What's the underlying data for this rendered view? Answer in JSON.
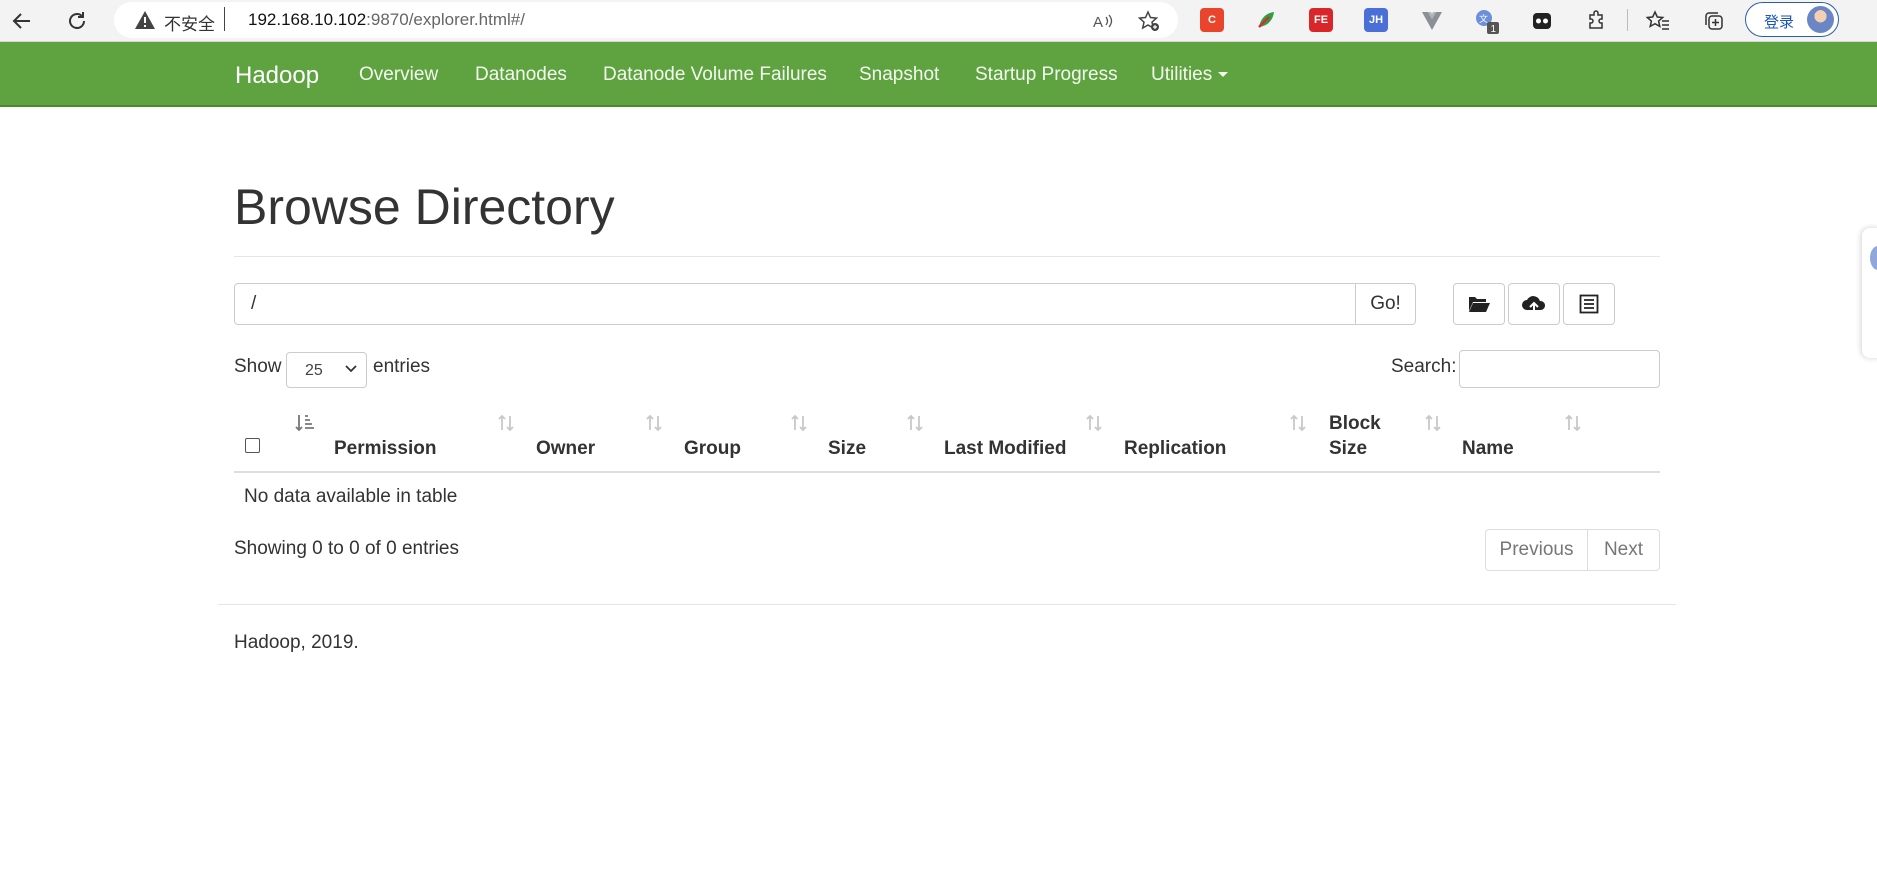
{
  "browser": {
    "insecure_label": "不安全",
    "url_host": "192.168.10.102",
    "url_rest": ":9870/explorer.html#/",
    "ext_icons": [
      {
        "name": "c-ext-icon",
        "label": "C",
        "color": "#e8452c"
      },
      {
        "name": "leaf-ext-icon",
        "label": "",
        "color": "#ffffff"
      },
      {
        "name": "fe-ext-icon",
        "label": "FE",
        "color": "#d9262a"
      },
      {
        "name": "jh-ext-icon",
        "label": "JH",
        "color": "#4a6fd6"
      }
    ],
    "badge_count": "1",
    "login_label": "登录"
  },
  "navbar": {
    "brand": "Hadoop",
    "items": [
      "Overview",
      "Datanodes",
      "Datanode Volume Failures",
      "Snapshot",
      "Startup Progress",
      "Utilities"
    ],
    "color": "#5fa341"
  },
  "main": {
    "title": "Browse Directory",
    "path_value": "/",
    "go_label": "Go!",
    "show_label": "Show",
    "entries_value": "25",
    "entries_label": "entries",
    "search_label": "Search:",
    "columns": [
      "Permission",
      "Owner",
      "Group",
      "Size",
      "Last Modified",
      "Replication",
      "Block Size",
      "Name"
    ],
    "empty_message": "No data available in table",
    "info": "Showing 0 to 0 of 0 entries",
    "prev_label": "Previous",
    "next_label": "Next"
  },
  "footer": {
    "text": "Hadoop, 2019."
  }
}
